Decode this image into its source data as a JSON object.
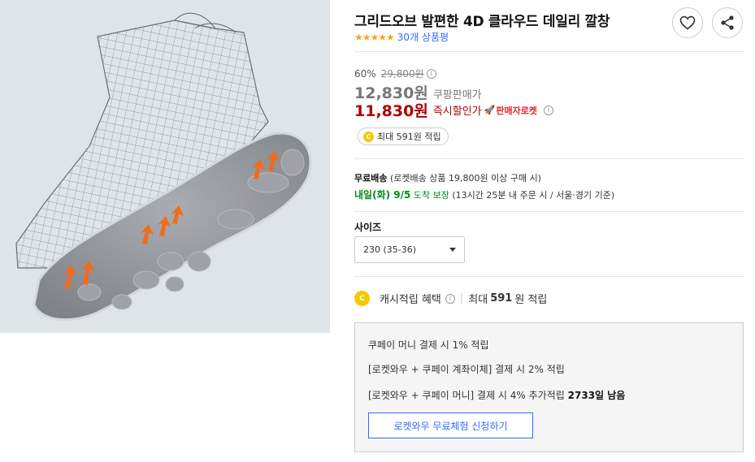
{
  "product": {
    "title": "그리드오브 발편한 4D 클라우드 데일리 깔창",
    "rating_stars": "★★★★★",
    "rating_value": 5,
    "review_count": "30개 상품평"
  },
  "actions": {
    "wishlist_icon": "heart-icon",
    "share_icon": "share-icon"
  },
  "price": {
    "discount_rate": "60%",
    "original_price": "29,800원",
    "info": "i",
    "coupang_price": "12,830원",
    "coupang_label": "쿠팡판매가",
    "instant_price": "11,830원",
    "instant_label": "즉시할인가",
    "seller_rocket": "판매자로켓"
  },
  "reward": {
    "coin": "C",
    "text": "최대 591원 적립"
  },
  "shipping": {
    "free_label": "무료배송",
    "free_note": "(로켓배송 상품 19,800원 이상 구매 시)",
    "arrival_day": "내일(화) 9/5",
    "arrival_label": "도착 보장",
    "arrival_note": "(13시간 25분  내 주문 시 / 서울⋅경기 기준)"
  },
  "size": {
    "label": "사이즈",
    "selected": "230 (35-36)"
  },
  "cash": {
    "coin": "C",
    "label": "캐시적립 혜택",
    "prefix": "최대",
    "amount": "591",
    "suffix": "원 적립"
  },
  "benefits": {
    "line1": "쿠페이 머니 결제 시 1% 적립",
    "line2": "[로켓와우 + 쿠페이 계좌이체] 결제 시 2% 적립",
    "line3_prefix": "[로켓와우 + 쿠페이 머니] 결제 시 4% 추가적립",
    "line3_bold": "2733일 남음",
    "trial_button": "로켓와우 무료체험 신청하기"
  },
  "colors": {
    "accent_blue": "#346aff",
    "price_red": "#ae0000",
    "delivery_green": "#00891a",
    "star_orange": "#f5a623",
    "coin_yellow": "#f6c700"
  }
}
